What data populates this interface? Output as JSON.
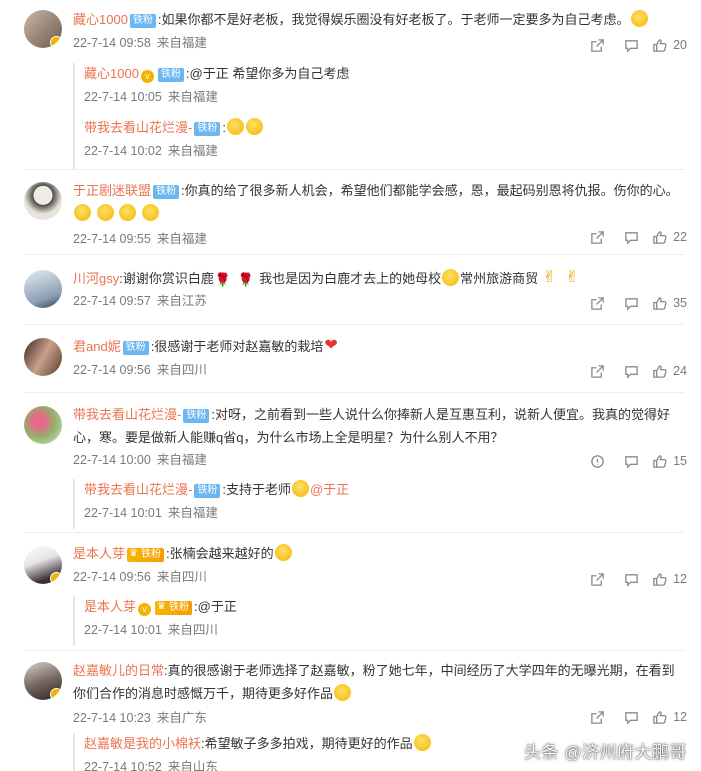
{
  "comments": [
    {
      "user": "藏心1000",
      "tag": "铁粉",
      "text": ":如果你都不是好老板，我觉得娱乐圈没有好老板了。于老师一定要多为自己考虑。",
      "date": "22-7-14 09:58",
      "source": "来自福建",
      "likes": "20",
      "replies": [
        {
          "user": "藏心1000",
          "tag": "铁粉",
          "text": ":@于正  希望你多为自己考虑",
          "date": "22-7-14 10:05",
          "source": "来自福建"
        },
        {
          "user": "带我去看山花烂漫-",
          "tag": "铁粉",
          "text": ":",
          "date": "22-7-14 10:02",
          "source": "来自福建"
        }
      ]
    },
    {
      "user": "于正剧迷联盟",
      "tag": "铁粉",
      "text": ":你真的给了很多新人机会，希望他们都能学会感，恩，最起码别恩将仇报。伤你的心。",
      "date": "22-7-14 09:55",
      "source": "来自福建",
      "likes": "22"
    },
    {
      "user": "川河gsy",
      "text_a": ":谢谢你赏识白鹿",
      "text_b": "我也是因为白鹿才去上的她母校",
      "text_c": "常州旅游商贸",
      "date": "22-7-14 09:57",
      "source": "来自江苏",
      "likes": "35"
    },
    {
      "user": "君and妮",
      "tag": "铁粉",
      "text": ":很感谢于老师对赵嘉敏的栽培",
      "date": "22-7-14 09:56",
      "source": "来自四川",
      "likes": "24"
    },
    {
      "user": "带我去看山花烂漫-",
      "tag": "铁粉",
      "text": ":对呀，之前看到一些人说什么你捧新人是互惠互利，说新人便宜。我真的觉得好心，寒。要是做新人能赚q省q，为什么市场上全是明星？为什么别人不用？",
      "date": "22-7-14 10:00",
      "source": "来自福建",
      "likes": "15",
      "replies": [
        {
          "user": "带我去看山花烂漫-",
          "tag": "铁粉",
          "text": ":支持于老师",
          "mention": "@于正",
          "date": "22-7-14 10:01",
          "source": "来自福建"
        }
      ]
    },
    {
      "user": "是本人芽",
      "tag": "铁粉",
      "text": ":张楠会越来越好的",
      "date": "22-7-14 09:56",
      "source": "来自四川",
      "likes": "12",
      "replies": [
        {
          "user": "是本人芽",
          "tag": "铁粉",
          "text": ":@于正",
          "date": "22-7-14 10:01",
          "source": "来自四川"
        }
      ]
    },
    {
      "user": "赵嘉敏儿的日常",
      "text": ":真的很感谢于老师选择了赵嘉敏，粉了她七年，中间经历了大学四年的无曝光期，在看到你们合作的消息时感慨万千，期待更多好作品",
      "date": "22-7-14 10:23",
      "source": "来自广东",
      "likes": "12",
      "replies": [
        {
          "user": "赵嘉敏是我的小棉袄",
          "text": ":希望敏子多多拍戏，期待更好的作品",
          "date": "22-7-14 10:52",
          "source": "来自山东"
        }
      ]
    }
  ],
  "watermark": "头条 @济州府大鹏哥",
  "icons": {
    "share": "share-icon",
    "comment": "comment-icon",
    "like": "thumbs-up-icon"
  },
  "colors": {
    "username": "#eb7350",
    "meta": "#7a7a7a",
    "fan_tag": "#6bb7f2"
  }
}
